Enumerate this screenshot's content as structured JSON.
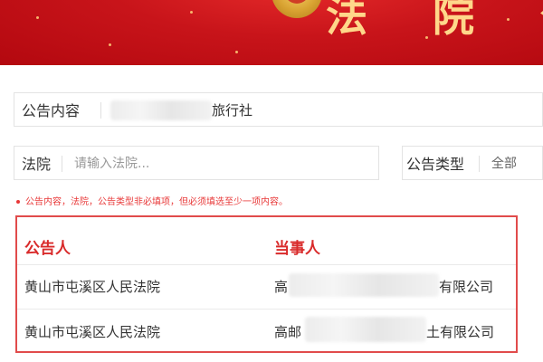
{
  "banner": {
    "title_fragment": "法 院 公"
  },
  "form": {
    "notice_content": {
      "label": "公告内容",
      "value_suffix": "旅行社"
    },
    "court": {
      "label": "法院",
      "placeholder": "请输入法院..."
    },
    "notice_type": {
      "label": "公告类型",
      "value": "全部"
    },
    "hint": "公告内容，法院，公告类型非必填项，但必须填选至少一项内容。"
  },
  "table": {
    "headers": [
      "公告人",
      "当事人"
    ],
    "rows": [
      {
        "announcer": "黄山市屯溪区人民法院",
        "party_prefix": "高",
        "party_suffix": "有限公司"
      },
      {
        "announcer": "黄山市屯溪区人民法院",
        "party_prefix": "高邮",
        "party_suffix": "土有限公司"
      }
    ]
  },
  "colors": {
    "banner_red": "#c8141a",
    "accent_red": "#d92b2b",
    "banner_gold": "#ffd78a"
  }
}
